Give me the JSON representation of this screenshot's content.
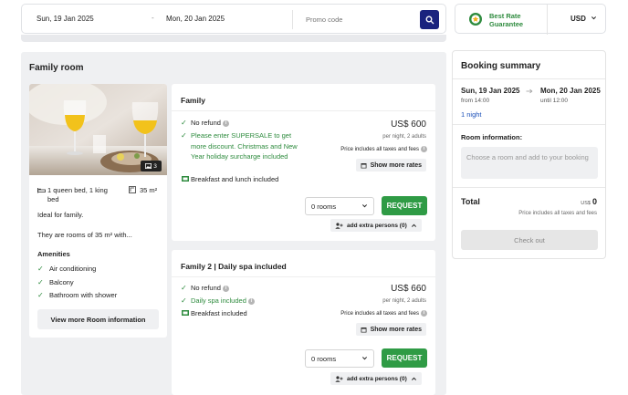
{
  "search": {
    "checkin": "Sun, 19 Jan 2025",
    "separator": "-",
    "checkout": "Mon, 20 Jan 2025",
    "promo_placeholder": "Promo code"
  },
  "badge": {
    "line1": "Best Rate",
    "line2": "Guarantee",
    "currency": "USD"
  },
  "section_title": "Family room",
  "room_card": {
    "gallery_count": "3",
    "bed": "1 queen bed, 1 king bed",
    "size": "35 m²",
    "ideal": "Ideal for family.",
    "desc": "They are rooms of 35 m² with...",
    "amenities_title": "Amenities",
    "amenities": [
      "Air conditioning",
      "Balcony",
      "Bathroom with shower"
    ],
    "view_more": "View more Room information"
  },
  "rates": [
    {
      "title": "Family",
      "no_refund": "No refund",
      "promo": "Please enter SUPERSALE to get more discount. Christmas and New Year holiday surcharge included",
      "meal": "Breakfast and lunch included",
      "price": "US$ 600",
      "per_night": "per night, 2 adults",
      "taxes": "Price includes all taxes and fees",
      "show_more": "Show more rates",
      "rooms_select": "0 rooms",
      "request": "REQUEST",
      "extra": "add extra persons (0)"
    },
    {
      "title": "Family 2 | Daily spa included",
      "no_refund": "No refund",
      "promo": "Daily spa included",
      "meal": "Breakfast included",
      "price": "US$ 660",
      "per_night": "per night, 2 adults",
      "taxes": "Price includes all taxes and fees",
      "show_more": "Show more rates",
      "rooms_select": "0 rooms",
      "request": "REQUEST",
      "extra": "add extra persons (0)"
    }
  ],
  "summary": {
    "title": "Booking summary",
    "checkin": "Sun, 19 Jan 2025",
    "checkin_time": "from 14:00",
    "checkout": "Mon, 20 Jan 2025",
    "checkout_time": "until 12:00",
    "nights": "1 night",
    "room_info_label": "Room information:",
    "room_info_placeholder": "Choose a room and add to your booking",
    "total_label": "Total",
    "total_currency": "US$",
    "total_amount": "0",
    "total_taxes": "Price includes all taxes and fees",
    "checkout_btn": "Check out"
  },
  "colors": {
    "accent_navy": "#1a237e",
    "green": "#2f9b45",
    "link_blue": "#1a4fb8"
  }
}
